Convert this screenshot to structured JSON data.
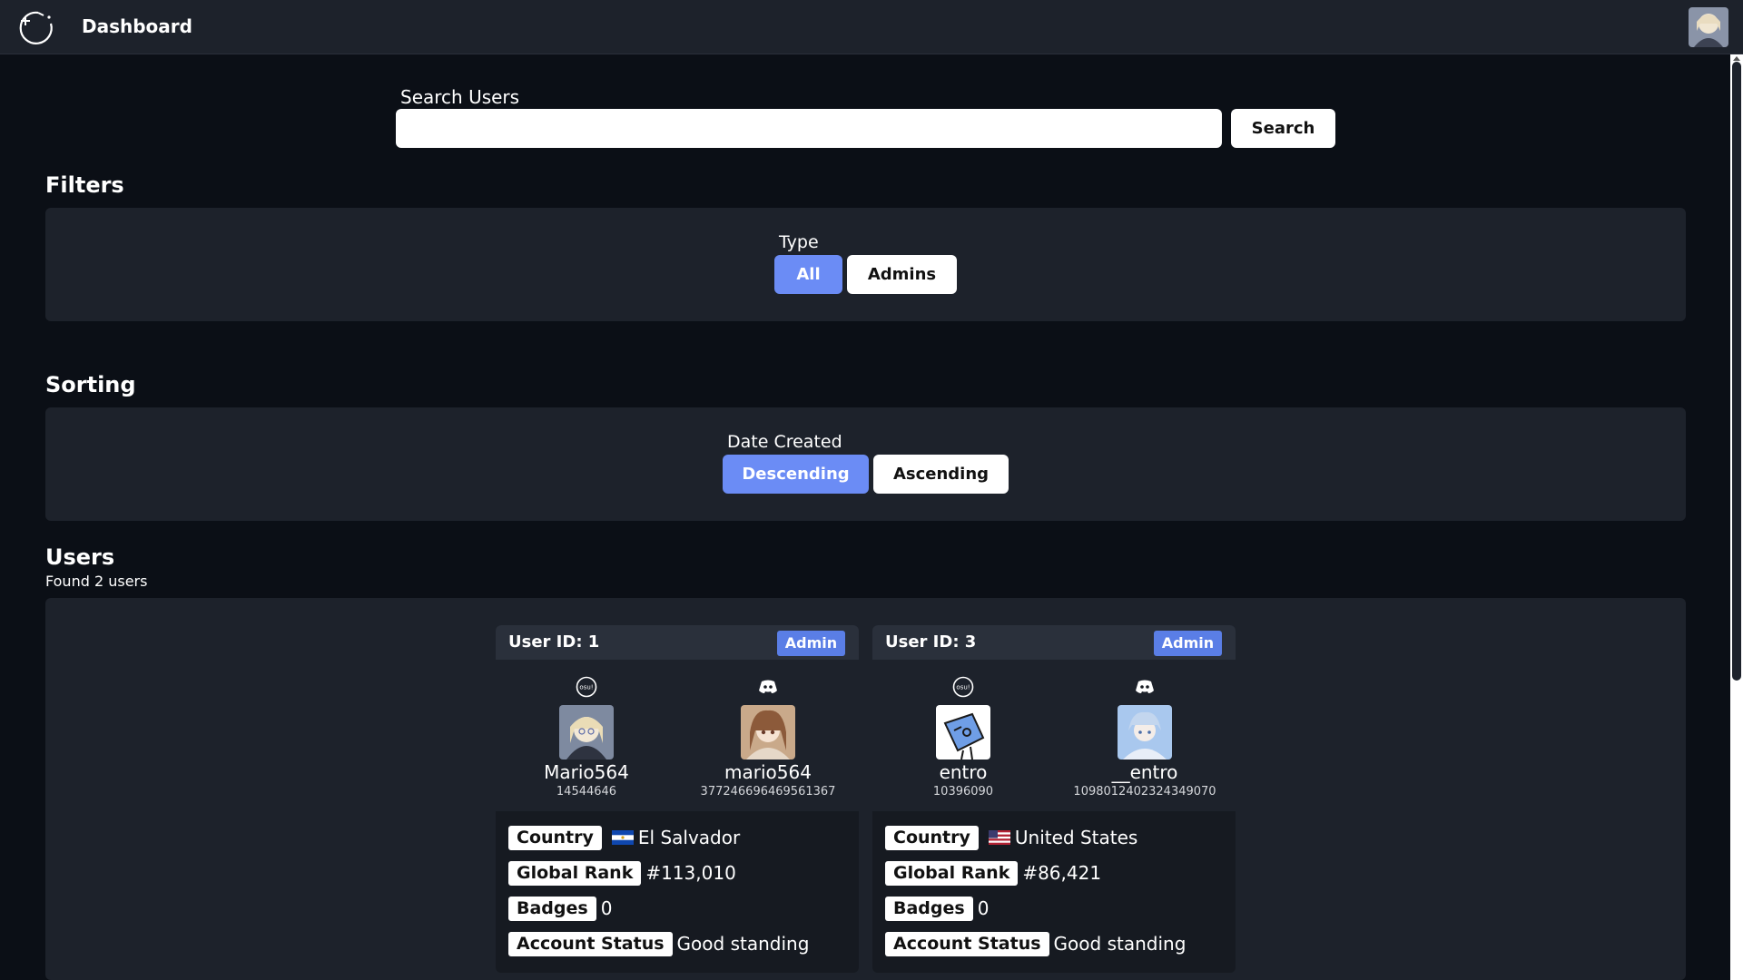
{
  "app": {
    "title": "Dashboard"
  },
  "icons": {
    "logo": "spinner-logo-icon",
    "osu": "osu-icon",
    "discord": "discord-icon"
  },
  "colors": {
    "background": "#0b0f16",
    "panel": "#1d222b",
    "accent": "#6b8cf5",
    "badge": "#5a7ee6"
  },
  "search": {
    "label": "Search Users",
    "value": "",
    "placeholder": "",
    "button": "Search"
  },
  "filters": {
    "title": "Filters",
    "type_label": "Type",
    "options": [
      "All",
      "Admins"
    ],
    "selected": "All"
  },
  "sorting": {
    "title": "Sorting",
    "label": "Date Created",
    "options": [
      "Descending",
      "Ascending"
    ],
    "selected": "Descending"
  },
  "users": {
    "title": "Users",
    "found": "Found 2 users",
    "list": [
      {
        "id_label": "User ID: 1",
        "badge": "Admin",
        "osu": {
          "name": "Mario564",
          "id": "14544646"
        },
        "discord": {
          "name": "mario564",
          "id": "377246696469561367"
        },
        "info": {
          "country_key": "Country",
          "country": "El Salvador",
          "rank_key": "Global Rank",
          "rank": "#113,010",
          "badges_key": "Badges",
          "badges": "0",
          "status_key": "Account Status",
          "status": "Good standing"
        }
      },
      {
        "id_label": "User ID: 3",
        "badge": "Admin",
        "osu": {
          "name": "entro",
          "id": "10396090"
        },
        "discord": {
          "name": "__entro",
          "id": "1098012402324349070"
        },
        "info": {
          "country_key": "Country",
          "country": "United States",
          "rank_key": "Global Rank",
          "rank": "#86,421",
          "badges_key": "Badges",
          "badges": "0",
          "status_key": "Account Status",
          "status": "Good standing"
        }
      }
    ]
  }
}
